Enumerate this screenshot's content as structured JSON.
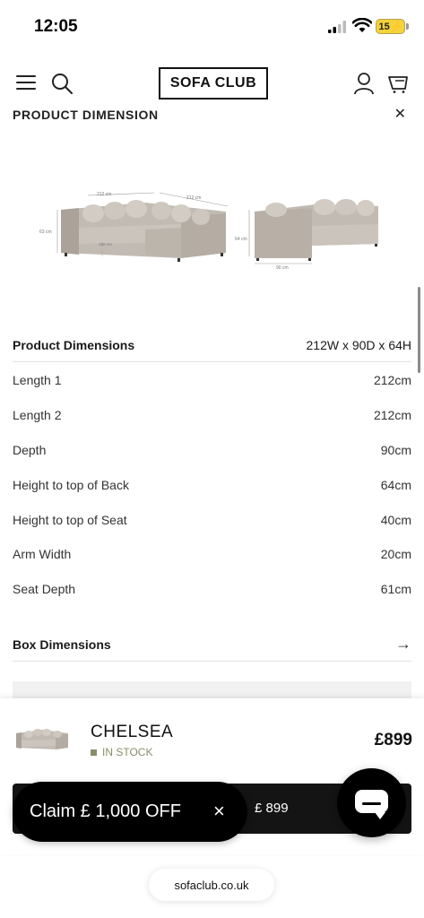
{
  "status_bar": {
    "time": "12:05",
    "battery": "15"
  },
  "header": {
    "logo": "SOFA CLUB"
  },
  "section": {
    "heading": "PRODUCT DIMENSION"
  },
  "diagram_labels": {
    "length1": "212 cm",
    "length2": "212 cm",
    "height_left": "63 cm",
    "inner": "150 cm",
    "height_right": "64 cm",
    "depth": "90 cm"
  },
  "dimensions": {
    "header": {
      "label": "Product Dimensions",
      "value": "212W x 90D x 64H"
    },
    "rows": [
      {
        "label": "Length 1",
        "value": "212cm"
      },
      {
        "label": "Length 2",
        "value": "212cm"
      },
      {
        "label": "Depth",
        "value": "90cm"
      },
      {
        "label": "Height to top of Back",
        "value": "64cm"
      },
      {
        "label": "Height to top of Seat",
        "value": "40cm"
      },
      {
        "label": "Arm Width",
        "value": "20cm"
      },
      {
        "label": "Seat Depth",
        "value": "61cm"
      }
    ],
    "box_label": "Box Dimensions"
  },
  "product": {
    "name": "CHELSEA",
    "stock": "IN STOCK",
    "price": "£899",
    "button_partial": "£ 899"
  },
  "promo": {
    "text": "Claim £ 1,000 OFF",
    "close": "×"
  },
  "browser": {
    "url": "sofaclub.co.uk"
  },
  "colors": {
    "stock": "#8a8d6a",
    "button": "#141414",
    "sofa": "#b5aea6"
  }
}
